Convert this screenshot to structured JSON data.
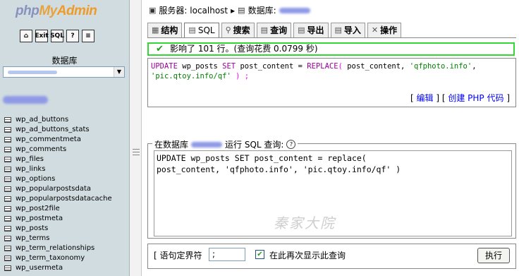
{
  "sidebar": {
    "logo": {
      "php": "php",
      "my": "My",
      "admin": "Admin"
    },
    "quick_icons": [
      {
        "name": "home-icon",
        "glyph": "⌂"
      },
      {
        "name": "exit-icon",
        "glyph": "Exit"
      },
      {
        "name": "sql-icon",
        "glyph": "SQL"
      },
      {
        "name": "help-icon",
        "glyph": "?"
      },
      {
        "name": "docs-icon",
        "glyph": "≡"
      }
    ],
    "db_label": "数据库",
    "tables": [
      "wp_ad_buttons",
      "wp_ad_buttons_stats",
      "wp_commentmeta",
      "wp_comments",
      "wp_files",
      "wp_links",
      "wp_options",
      "wp_popularpostsdata",
      "wp_popularpostsdatacache",
      "wp_post2file",
      "wp_postmeta",
      "wp_posts",
      "wp_terms",
      "wp_term_relationships",
      "wp_term_taxonomy",
      "wp_usermeta"
    ]
  },
  "breadcrumb": {
    "server_label": "服务器: localhost",
    "separator": "▸",
    "db_label": "数据库:"
  },
  "tabs": [
    {
      "label": "结构",
      "icon": "structure-icon",
      "glyph": "▦",
      "active": false
    },
    {
      "label": "SQL",
      "icon": "sql-icon",
      "glyph": "▤",
      "active": true
    },
    {
      "label": "搜索",
      "icon": "search-icon",
      "glyph": "⚲",
      "active": false
    },
    {
      "label": "查询",
      "icon": "query-icon",
      "glyph": "▤",
      "active": false
    },
    {
      "label": "导出",
      "icon": "export-icon",
      "glyph": "▤",
      "active": false
    },
    {
      "label": "导入",
      "icon": "import-icon",
      "glyph": "▤",
      "active": false
    },
    {
      "label": "操作",
      "icon": "operations-icon",
      "glyph": "✕",
      "active": false
    }
  ],
  "result": {
    "message": "影响了 101 行。(查询花费 0.0799 秒)"
  },
  "executed_sql": {
    "kw1": "UPDATE",
    "table": " wp_posts ",
    "kw2": "SET",
    "col": " post_content = ",
    "fn": "REPLACE",
    "open": "(",
    "arg1": " post_content, ",
    "str1": "'qfphoto.info'",
    "comma": ",",
    "str2": "'pic.qtoy.info/qf'",
    "close": " ) ;"
  },
  "actions": {
    "open_bracket": "[ ",
    "edit": "编辑",
    "middle": " ] [ ",
    "create_php": "创建 PHP 代码",
    "close_bracket": " ]"
  },
  "query_box": {
    "legend_prefix": "在数据库",
    "legend_suffix": "运行 SQL 查询:",
    "text": "UPDATE wp_posts SET post_content = replace(\npost_content, 'qfphoto.info', 'pic.qtoy.info/qf' )"
  },
  "watermark": "秦家大院",
  "bottom": {
    "delimiter_label": "[ 语句定界符",
    "delimiter_value": ";",
    "show_again_label": "在此再次显示此查询",
    "show_again_checked": true,
    "go_label": "执行"
  }
}
